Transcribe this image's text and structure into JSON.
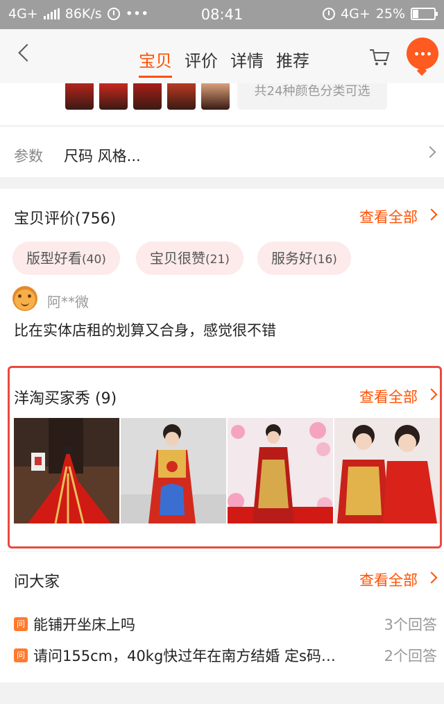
{
  "status_bar": {
    "network": "4G+",
    "speed": "86K/s",
    "dots": "•••",
    "time": "08:41",
    "network_right": "4G+",
    "battery": "25%",
    "battery_level": 0.25
  },
  "nav": {
    "tabs": [
      "宝贝",
      "评价",
      "详情",
      "推荐"
    ],
    "active_tab": "宝贝"
  },
  "sku": {
    "colors_label": "共24种颜色分类可选",
    "thumb_colors": [
      "#b3241c",
      "#c8281e",
      "#a81d18",
      "#b83a22",
      "#d9a07a"
    ]
  },
  "params": {
    "label": "参数",
    "value": "尺码 风格..."
  },
  "reviews": {
    "title": "宝贝评价(756)",
    "view_all": "查看全部",
    "tags": [
      {
        "label": "版型好看",
        "count": "(40)"
      },
      {
        "label": "宝贝很赞",
        "count": "(21)"
      },
      {
        "label": "服务好",
        "count": "(16)"
      }
    ],
    "user": "阿**微",
    "comment": "比在实体店租的划算又合身，感觉很不错"
  },
  "buyer_show": {
    "title": "洋淘买家秀 (9)",
    "view_all": "查看全部"
  },
  "ask": {
    "title": "问大家",
    "view_all": "查看全部",
    "icon_label": "问",
    "questions": [
      {
        "text": "能铺开坐床上吗",
        "answers": "3个回答"
      },
      {
        "text": "请问155cm，40kg快过年在南方结婚 定s码…",
        "answers": "2个回答"
      }
    ]
  },
  "colors": {
    "accent": "#ff5000",
    "highlight_border": "#e84a3e",
    "tag_bg": "#fdeaea"
  }
}
